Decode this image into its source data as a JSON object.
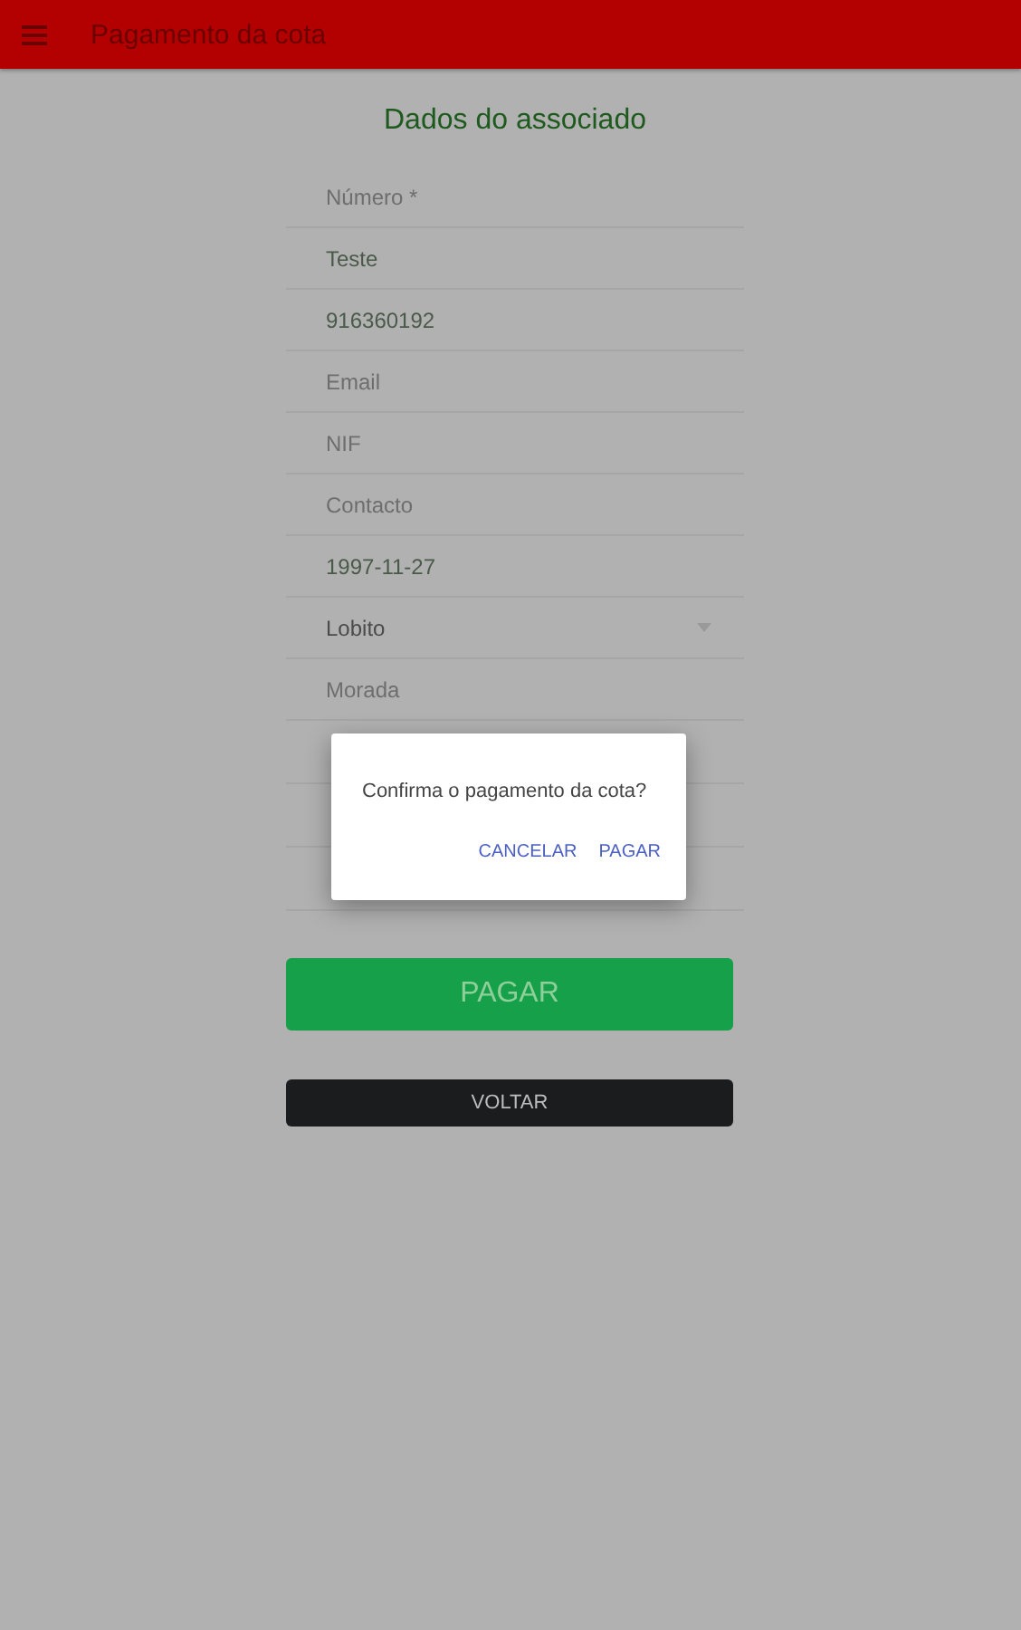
{
  "header": {
    "title": "Pagamento da cota"
  },
  "form": {
    "title": "Dados do associado",
    "fields": [
      {
        "kind": "input",
        "placeholder": "Número *"
      },
      {
        "kind": "input",
        "value": "Teste"
      },
      {
        "kind": "input",
        "value": "916360192"
      },
      {
        "kind": "input",
        "placeholder": "Email"
      },
      {
        "kind": "input",
        "placeholder": "NIF"
      },
      {
        "kind": "input",
        "placeholder": "Contacto"
      },
      {
        "kind": "input",
        "value": "1997-11-27"
      },
      {
        "kind": "select",
        "value": "Lobito"
      },
      {
        "kind": "input",
        "placeholder": "Morada"
      }
    ],
    "buttons": [
      {
        "kind": "primary",
        "label": "PAGAR"
      },
      {
        "kind": "dark",
        "label": "VOLTAR"
      }
    ]
  },
  "dialog": {
    "message": "Confirma o pagamento da cota?",
    "actions": [
      "CANCELAR",
      "PAGAR"
    ]
  }
}
